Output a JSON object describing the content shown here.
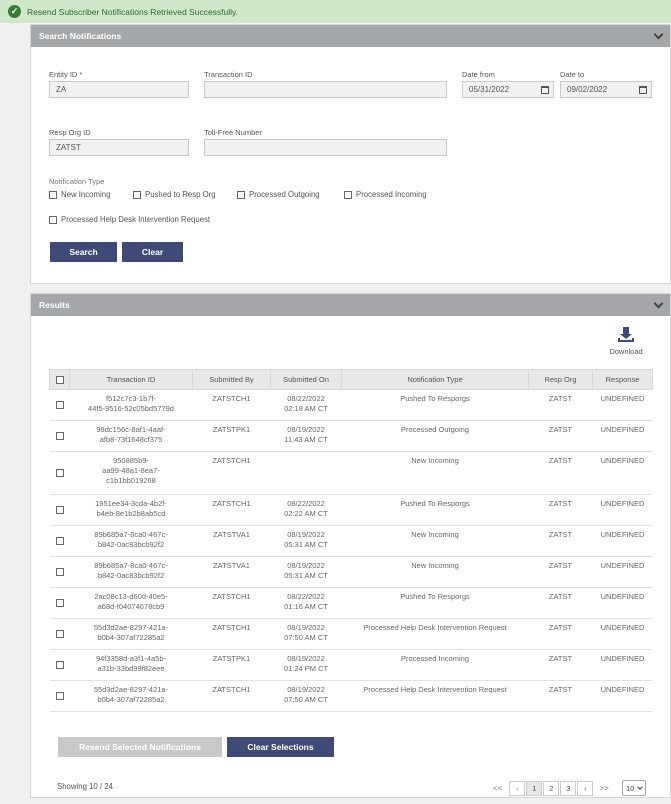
{
  "toast": {
    "message": "Resend Subscriber Notifications Retrieved Successfully."
  },
  "search": {
    "title": "Search Notifications",
    "entity_label": "Entity ID *",
    "entity_value": "ZA",
    "transaction_label": "Transaction ID",
    "transaction_value": "",
    "date_from_label": "Date from",
    "date_from_value": "05/31/2022",
    "date_to_label": "Date to",
    "date_to_value": "09/02/2022",
    "resp_org_label": "Resp Org ID",
    "resp_org_value": "ZATST",
    "tollfree_label": "Toll-Free Number",
    "tollfree_value": "",
    "notification_type_label": "Notification Type",
    "types": [
      "New Incoming",
      "Pushed to Resp Org",
      "Processed Outgoing",
      "Processed Incoming",
      "Processed Help Desk Intervention Request"
    ],
    "search_button": "Search",
    "clear_button": "Clear"
  },
  "results": {
    "title": "Results",
    "download_label": "Download",
    "columns": [
      "Transaction ID",
      "Submitted By",
      "Submitted On",
      "Notification Type",
      "Resp Org",
      "Response"
    ],
    "rows": [
      {
        "id1": "f512c7c3-1b7f-",
        "id2": "44f5-9516-52c05bd5779d",
        "id3": "",
        "by": "ZATSTCH1",
        "d1": "08/22/2022",
        "d2": "02:18 AM CT",
        "type": "Pushed To Resporgs",
        "org": "ZATST",
        "resp": "UNDEFINED"
      },
      {
        "id1": "98dc156c-8af1-4aaf-",
        "id2": "afb8-73f1648cf375",
        "id3": "",
        "by": "ZATSTPK1",
        "d1": "08/19/2022",
        "d2": "11:43 AM CT",
        "type": "Processed Outgoing",
        "org": "ZATST",
        "resp": "UNDEFINED"
      },
      {
        "id1": "950885b9-",
        "id2": "aa99-48a1-8ea7-",
        "id3": "c1b1bb019268",
        "by": "ZATSTCH1",
        "d1": "",
        "d2": "",
        "type": "New Incoming",
        "org": "ZATST",
        "resp": "UNDEFINED"
      },
      {
        "id1": "1951ee34-3cda-4b2f-",
        "id2": "b4eb-8e1b2b8ab5cd",
        "id3": "",
        "by": "ZATSTCH1",
        "d1": "08/22/2022",
        "d2": "02:22 AM CT",
        "type": "Pushed To Resporgs",
        "org": "ZATST",
        "resp": "UNDEFINED"
      },
      {
        "id1": "89b685a7-8ca0-467c-",
        "id2": "b842-0ac83bcb92f2",
        "id3": "",
        "by": "ZATSTVA1",
        "d1": "08/19/2022",
        "d2": "05:31 AM CT",
        "type": "New Incoming",
        "org": "ZATST",
        "resp": "UNDEFINED"
      },
      {
        "id1": "89b685a7-8ca0-467c-",
        "id2": "b842-0ac83bcb92f2",
        "id3": "",
        "by": "ZATSTVA1",
        "d1": "08/19/2022",
        "d2": "05:31 AM CT",
        "type": "New Incoming",
        "org": "ZATST",
        "resp": "UNDEFINED"
      },
      {
        "id1": "2ac08c13-d60d-40e5-",
        "id2": "a68d-f04074678cb9",
        "id3": "",
        "by": "ZATSTCH1",
        "d1": "08/22/2022",
        "d2": "01:16 AM CT",
        "type": "Pushed To Resporgs",
        "org": "ZATST",
        "resp": "UNDEFINED"
      },
      {
        "id1": "55d3d2ae-8297-421a-",
        "id2": "b0b4-307af72285a2",
        "id3": "",
        "by": "ZATSTCH1",
        "d1": "08/19/2022",
        "d2": "07:50 AM CT",
        "type": "Processed Help Desk Intervention Request",
        "org": "ZATST",
        "resp": "UNDEFINED"
      },
      {
        "id1": "94f3358d-a3f1-4a5b-",
        "id2": "a31b-33bd99f82eee",
        "id3": "",
        "by": "ZATSTPK1",
        "d1": "08/19/2022",
        "d2": "01:24 PM CT",
        "type": "Processed Incoming",
        "org": "ZATST",
        "resp": "UNDEFINED"
      },
      {
        "id1": "55d3d2ae-8297-421a-",
        "id2": "b0b4-307af72285a2",
        "id3": "",
        "by": "ZATSTCH1",
        "d1": "08/19/2022",
        "d2": "07:50 AM CT",
        "type": "Processed Help Desk Intervention Request",
        "org": "ZATST",
        "resp": "UNDEFINED"
      }
    ],
    "resend_button": "Resend Selected Notifications",
    "clear_selections_button": "Clear Selections",
    "showing": "Showing 10 / 24",
    "pages": [
      "1",
      "2",
      "3"
    ],
    "first": "<<",
    "prev": "‹",
    "next": "›",
    "last": ">>",
    "page_size": "10"
  },
  "colors": {
    "primary": "#3f4b76",
    "header_grey": "#a5a8ab",
    "toast_bg": "#cfe8c9"
  }
}
